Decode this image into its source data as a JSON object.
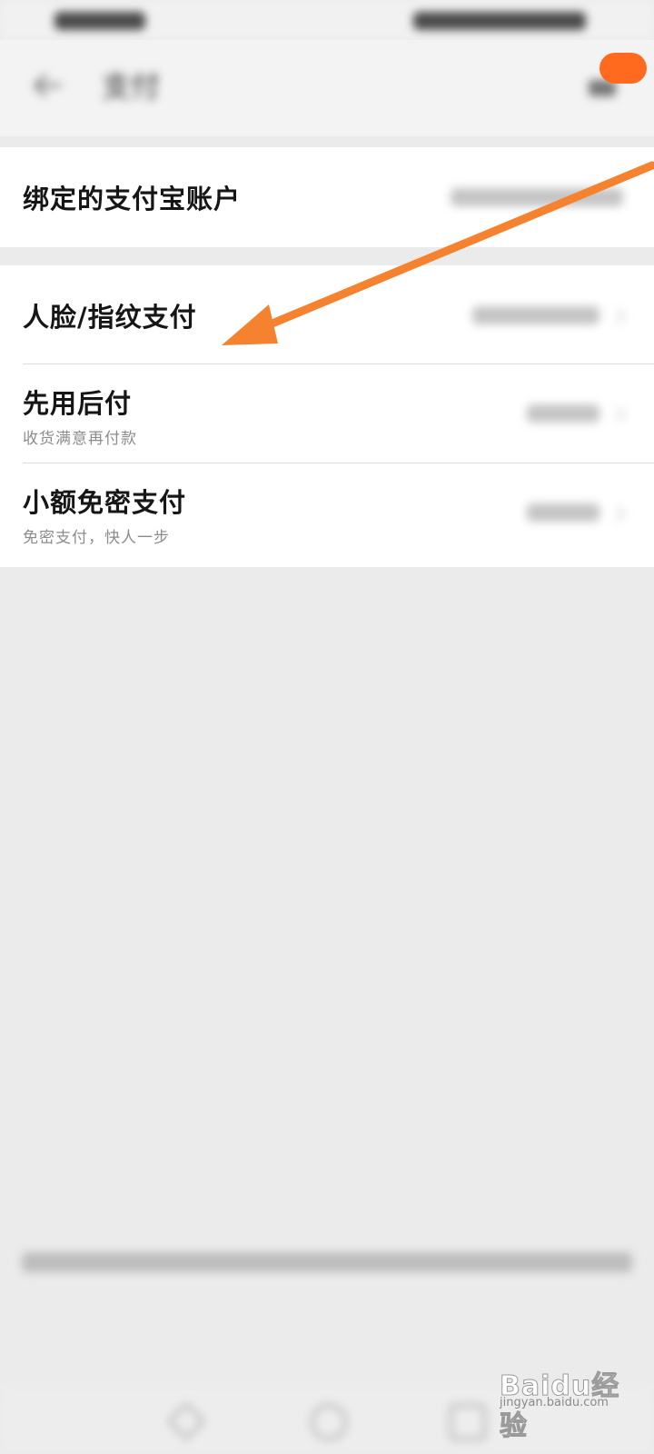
{
  "header": {
    "title": "支付"
  },
  "rows": [
    {
      "title": "绑定的支付宝账户"
    },
    {
      "title": "人脸/指纹支付"
    },
    {
      "title": "先用后付",
      "subtitle": "收货满意再付款"
    },
    {
      "title": "小额免密支付",
      "subtitle": "免密支付，快人一步"
    }
  ],
  "watermark": {
    "brand": "Baidu经验",
    "domain": "jingyan.baidu.com"
  },
  "annotation": {
    "arrow_color": "#f5822f"
  },
  "colors": {
    "accent": "#ff6a1e",
    "background": "#ebebeb",
    "card": "#ffffff"
  }
}
